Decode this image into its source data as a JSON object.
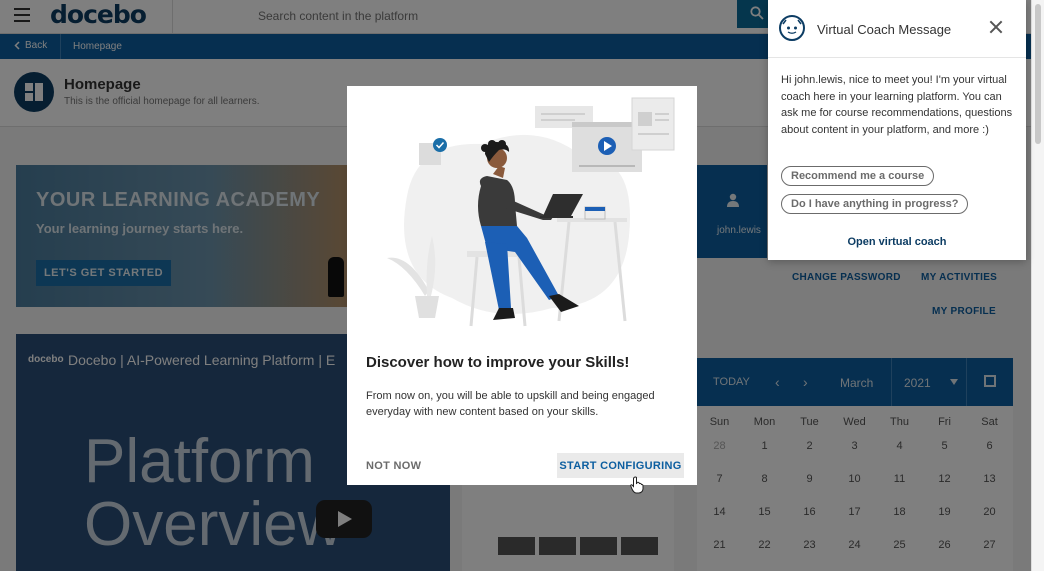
{
  "app": {
    "logo": "docebo",
    "search": {
      "placeholder": "Search content in the platform"
    }
  },
  "nav": {
    "back_label": "Back",
    "crumb": "Homepage"
  },
  "page": {
    "title": "Homepage",
    "subtitle": "This is the official homepage for all learners."
  },
  "banner": {
    "title": "YOUR LEARNING ACADEMY",
    "subtitle": "Your learning journey starts here.",
    "cta": "LET'S GET STARTED"
  },
  "video": {
    "logo": "docebo",
    "title": "Docebo | AI-Powered Learning Platform | E",
    "line1": "Platform",
    "line2": "Overview"
  },
  "profile": {
    "username": "john.lewis",
    "links": {
      "change_password": "CHANGE PASSWORD",
      "my_activities": "MY ACTIVITIES",
      "my_profile": "MY PROFILE"
    }
  },
  "calendar": {
    "today": "TODAY",
    "month": "March",
    "year": "2021",
    "days": [
      "Sun",
      "Mon",
      "Tue",
      "Wed",
      "Thu",
      "Fri",
      "Sat"
    ],
    "weeks": [
      [
        "28",
        "1",
        "2",
        "3",
        "4",
        "5",
        "6"
      ],
      [
        "7",
        "8",
        "9",
        "10",
        "11",
        "12",
        "13"
      ],
      [
        "14",
        "15",
        "16",
        "17",
        "18",
        "19",
        "20"
      ],
      [
        "21",
        "22",
        "23",
        "24",
        "25",
        "26",
        "27"
      ]
    ]
  },
  "coach": {
    "title": "Virtual Coach Message",
    "message": "Hi john.lewis, nice to meet you! I'm your virtual coach here in your learning platform. You can ask me for course recommendations, questions about content in your platform, and more :)",
    "chips": [
      "Recommend me a course",
      "Do I have anything in progress?"
    ],
    "open_label": "Open virtual coach"
  },
  "modal": {
    "title": "Discover how to improve your Skills!",
    "text": "From now on, you will be able to upskill and being engaged everyday with new content based on your skills.",
    "not_now": "NOT NOW",
    "start": "START CONFIGURING"
  },
  "colors": {
    "brand_dark": "#0c3c63",
    "brand_blue": "#0c5ea0",
    "illustration_blue": "#1c5fb5",
    "check_blue": "#1a6ea8"
  }
}
